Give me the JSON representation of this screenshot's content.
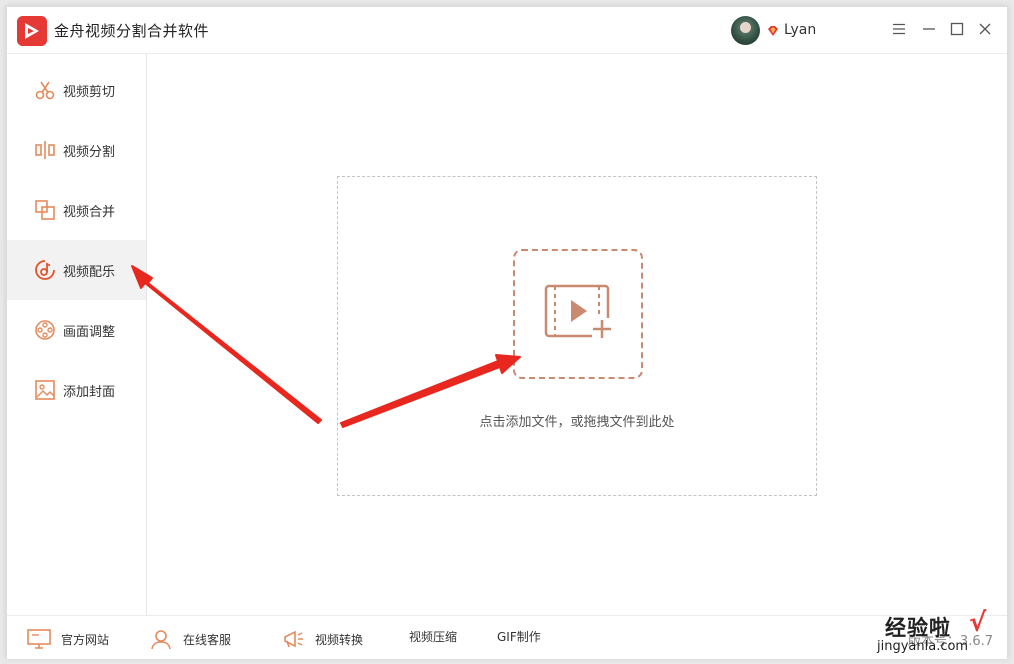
{
  "app": {
    "title": "金舟视频分割合并软件",
    "user_name": "Lyan"
  },
  "colors": {
    "brand_red": "#e53935",
    "icon_orange": "#e58a5c",
    "drop_accent": "#c98a70",
    "arrow_red": "#e8271f"
  },
  "sidebar": {
    "items": [
      {
        "label": "视频剪切",
        "icon": "scissors-icon"
      },
      {
        "label": "视频分割",
        "icon": "split-icon"
      },
      {
        "label": "视频合并",
        "icon": "merge-icon"
      },
      {
        "label": "视频配乐",
        "icon": "music-icon",
        "active": true
      },
      {
        "label": "画面调整",
        "icon": "film-reel-icon"
      },
      {
        "label": "添加封面",
        "icon": "image-icon"
      }
    ]
  },
  "main": {
    "drop_hint": "点击添加文件，或拖拽文件到此处"
  },
  "footer": {
    "items": [
      {
        "label": "官方网站",
        "icon": "monitor-icon"
      },
      {
        "label": "在线客服",
        "icon": "headset-icon"
      },
      {
        "label": "视频转换",
        "icon": "megaphone-icon"
      },
      {
        "label": "视频压缩"
      },
      {
        "label": "GIF制作"
      }
    ],
    "version": "版本号：3.6.7"
  },
  "watermark": {
    "title": "经验啦",
    "check": "√",
    "url": "jingyanla.com"
  }
}
